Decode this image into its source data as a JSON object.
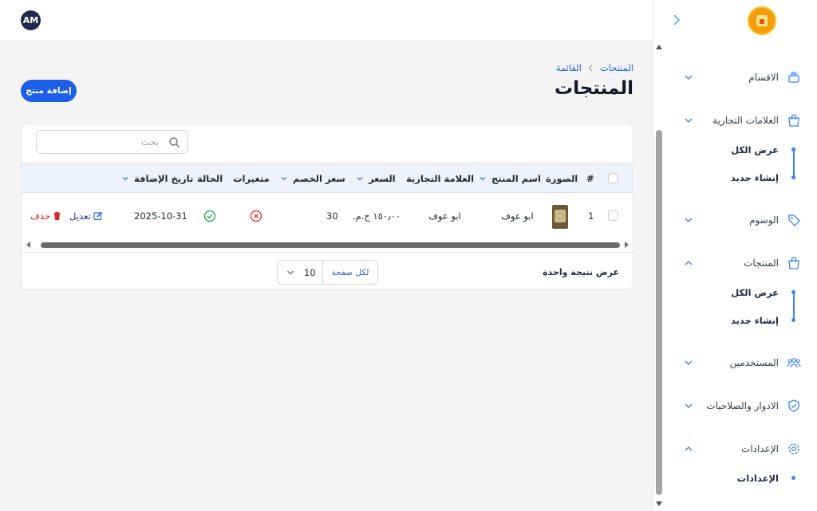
{
  "header": {
    "avatar_initials": "AM"
  },
  "breadcrumb": {
    "items": [
      "المنتجات",
      "القائمة"
    ]
  },
  "page": {
    "title": "المنتجات",
    "add_button_label": "إضافة منتج"
  },
  "search": {
    "placeholder": "بحث",
    "value": ""
  },
  "table": {
    "columns": [
      "#",
      "الصورة",
      "اسم المنتج",
      "العلامة التجارية",
      "السعر",
      "سعر الخصم",
      "متغيرات",
      "الحالة",
      "تاريخ الإضافة"
    ],
    "rows": [
      {
        "index": "1",
        "name": "ابو عوف",
        "brand": "ابو عوف",
        "price": "١٥٠٫٠٠ ج.م.",
        "discount_price": "30",
        "has_variants": false,
        "status_active": true,
        "date_added": "2025-10-31",
        "edit_label": "تعديل",
        "delete_label": "حذف"
      }
    ]
  },
  "footer": {
    "results_text": "عرض نتيجة واحدة",
    "per_page_label": "لكل صفحة",
    "per_page_value": "10"
  },
  "sidebar": {
    "items": [
      {
        "label": "الاقسام",
        "icon": "layers-icon",
        "expanded": false
      },
      {
        "label": "العلامات التجارية",
        "icon": "shopping-bag-icon",
        "expanded": true,
        "children": [
          "عرض الكل",
          "إنشاء جديد"
        ]
      },
      {
        "label": "الوسوم",
        "icon": "tag-icon",
        "expanded": false
      },
      {
        "label": "المنتجات",
        "icon": "shopping-bag-icon",
        "expanded": true,
        "children": [
          "عرض الكل",
          "إنشاء جديد"
        ]
      },
      {
        "label": "المستخدمين",
        "icon": "users-icon",
        "expanded": false
      },
      {
        "label": "الادوار والصلاحيات",
        "icon": "shield-check-icon",
        "expanded": false
      },
      {
        "label": "الإعدادات",
        "icon": "gear-icon",
        "expanded": true,
        "children": [
          "الإعدادات"
        ]
      }
    ]
  },
  "colors": {
    "primary": "#1d5ee8",
    "link": "#2563eb",
    "danger": "#dc2626",
    "success": "#16a34a",
    "sidebar_accent": "#3b82f6"
  }
}
